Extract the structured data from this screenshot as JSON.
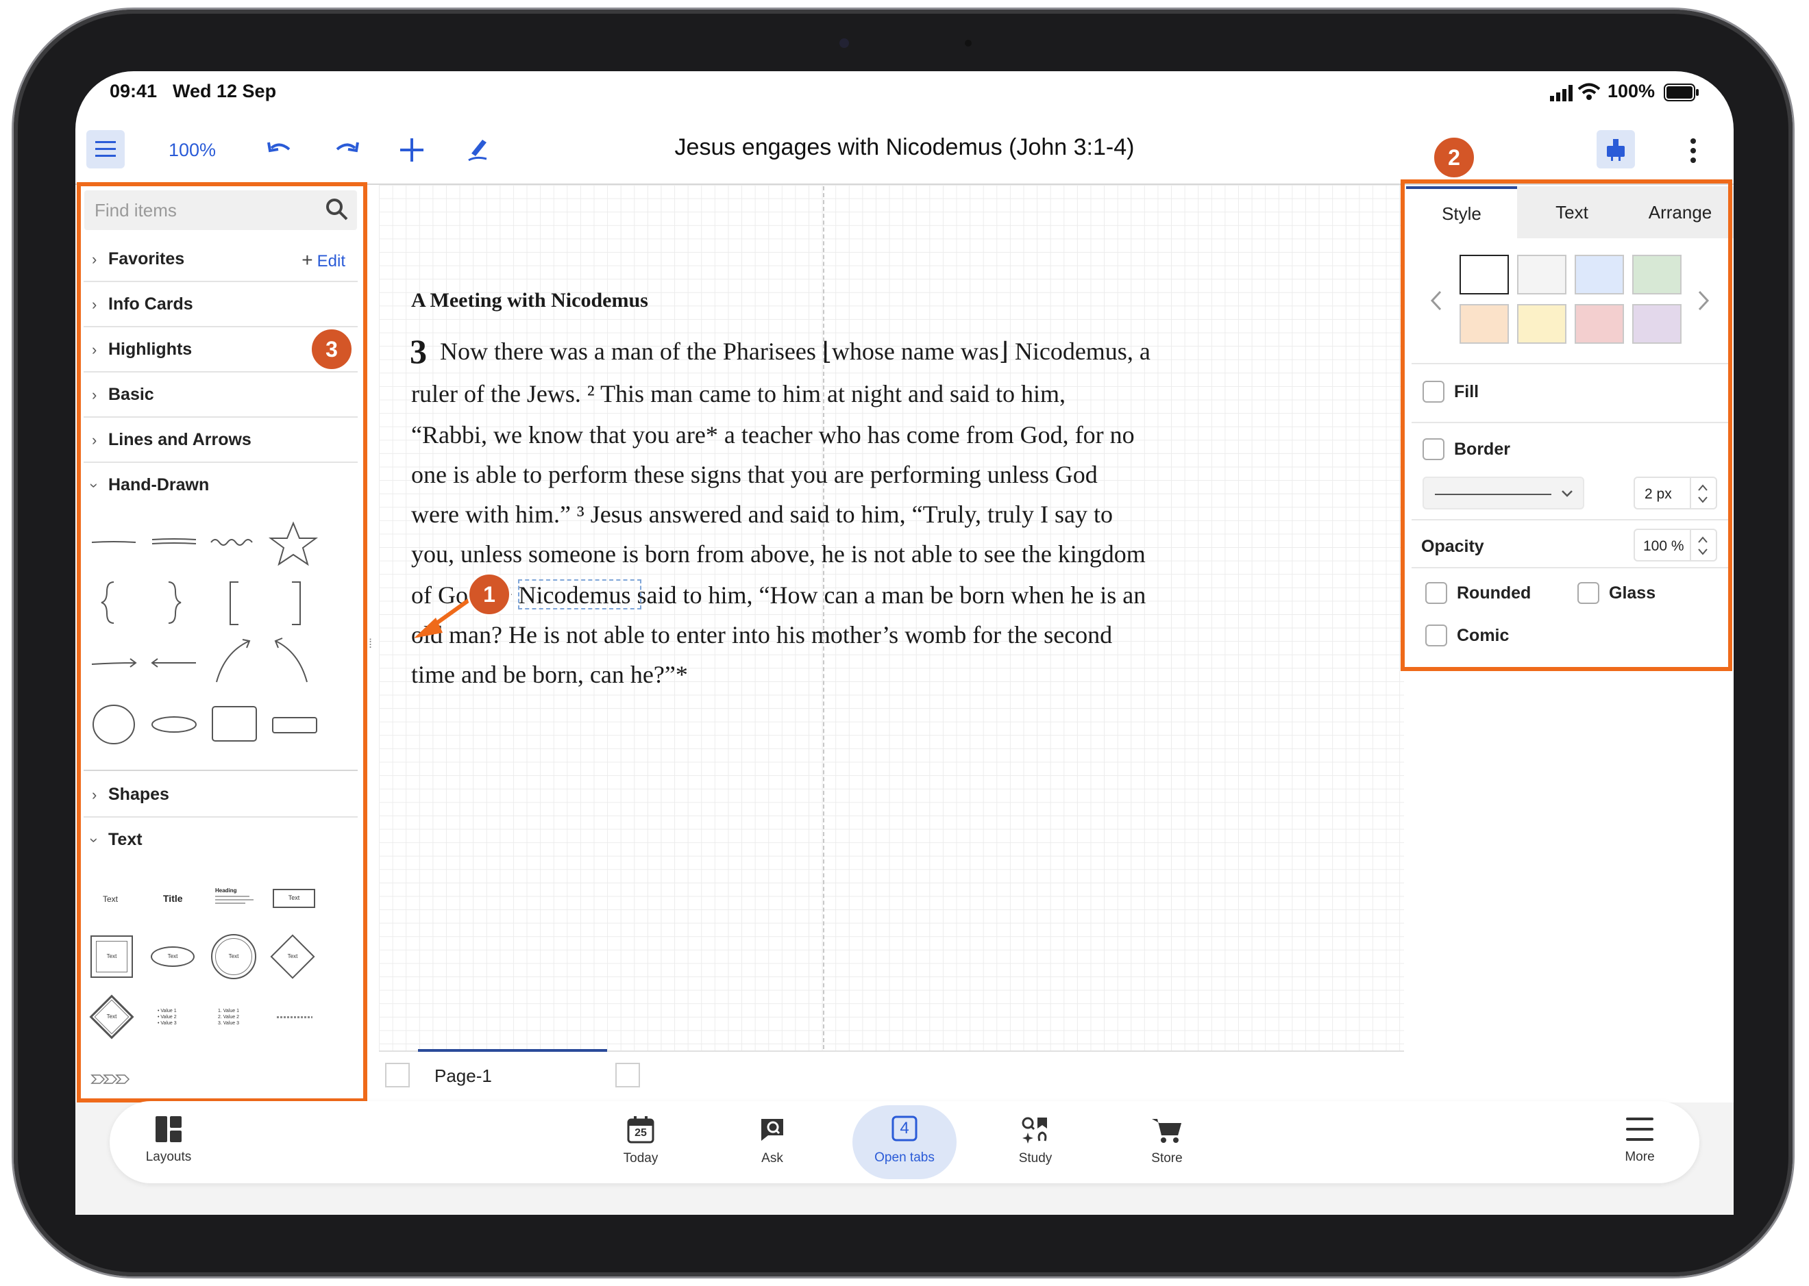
{
  "status_bar": {
    "time": "09:41",
    "date": "Wed 12 Sep",
    "battery": "100%"
  },
  "toolbar": {
    "zoom": "100%",
    "document_title": "Jesus engages with Nicodemus (John 3:1-4)"
  },
  "left_panel": {
    "search_placeholder": "Find items",
    "sections": [
      {
        "label": "Favorites",
        "expanded": false
      },
      {
        "label": "Info Cards",
        "expanded": false
      },
      {
        "label": "Highlights",
        "expanded": false
      },
      {
        "label": "Basic",
        "expanded": false
      },
      {
        "label": "Lines and Arrows",
        "expanded": false
      },
      {
        "label": "Hand-Drawn",
        "expanded": true
      },
      {
        "label": "Shapes",
        "expanded": false
      },
      {
        "label": "Text",
        "expanded": true
      }
    ],
    "favorites_edit": "Edit",
    "text_section": {
      "text": "Text",
      "title": "Title",
      "heading": "Heading",
      "list_items": [
        "Value 1",
        "Value 2",
        "Value 3"
      ],
      "numbered_items": [
        "1. Value 1",
        "2. Value 2",
        "3. Value 3"
      ]
    }
  },
  "canvas": {
    "heading": "A Meeting with Nicodemus",
    "chapter": "3",
    "lines": [
      "Now there was a man of the Pharisees ⌊whose name was⌋ Nicodemus, a",
      "ruler of the Jews. ² This man came to him at night and said to him,",
      "“Rabbi, we know that you are* a teacher who has come from God, for no",
      "one is able to perform these signs that you are performing unless God",
      "were with him.” ³ Jesus answered and said to him, “Truly, truly I say to",
      "you, unless someone is born from above, he is not able to see the kingdom",
      "of God.” ⁴ Nicodemus said to him, “How can a man be born when he is an",
      "old man? He is not able to enter into his mother’s womb for the second",
      "time and be born, can he?”*"
    ],
    "selected_word": "Nicodemus",
    "page_tab": "Page-1"
  },
  "right_panel": {
    "tabs": [
      "Style",
      "Text",
      "Arrange"
    ],
    "active_tab": "Style",
    "swatches": [
      "#ffffff",
      "#f4f4f4",
      "#dde8fb",
      "#d7e8d5",
      "#fbe2c9",
      "#fcf1c7",
      "#f3cfcf",
      "#e3d8eb"
    ],
    "fill_label": "Fill",
    "border_label": "Border",
    "border_width": "2 px",
    "opacity_label": "Opacity",
    "opacity_value": "100 %",
    "rounded_label": "Rounded",
    "glass_label": "Glass",
    "comic_label": "Comic"
  },
  "annotations": [
    "1",
    "2",
    "3"
  ],
  "bottom_nav": {
    "layouts": "Layouts",
    "today": "Today",
    "today_date": "25",
    "ask": "Ask",
    "open_tabs": "Open tabs",
    "open_tabs_count": "4",
    "study": "Study",
    "store": "Store",
    "more": "More"
  },
  "colors": {
    "accent": "#2a5bd7",
    "annotation": "#ef6a1a",
    "badge": "#d45627"
  }
}
